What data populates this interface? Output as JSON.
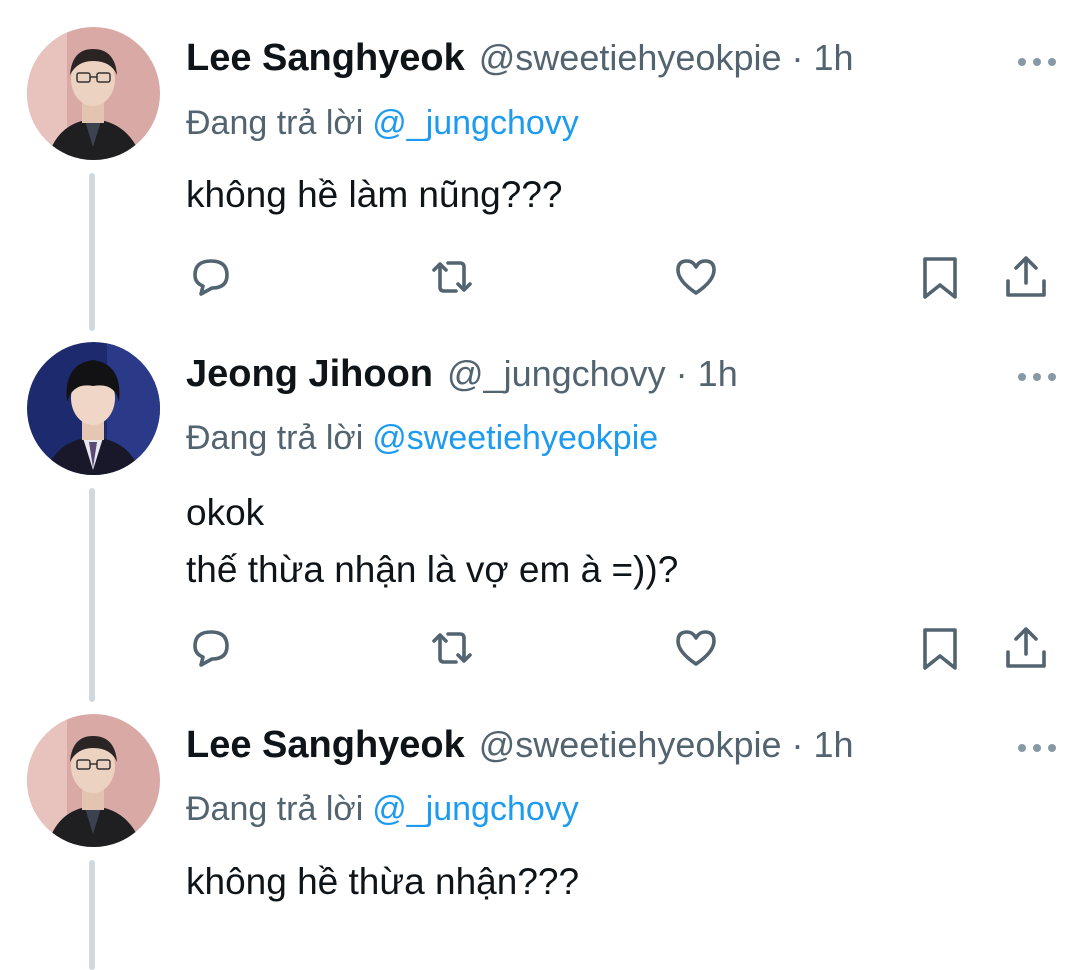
{
  "tweets": [
    {
      "name": "Lee Sanghyeok",
      "handle": "@sweetiehyeokpie",
      "dot": "·",
      "time": "1h",
      "reply_prefix": "Đang trả lời",
      "reply_to": "@_jungchovy",
      "lines": [
        "không hề làm nũng???"
      ],
      "avatar": "avatar-lee-sanghyeok"
    },
    {
      "name": "Jeong Jihoon",
      "handle": "@_jungchovy",
      "dot": "·",
      "time": "1h",
      "reply_prefix": "Đang trả lời",
      "reply_to": "@sweetiehyeokpie",
      "lines": [
        "okok",
        "thế thừa nhận là vợ em à =))?"
      ],
      "avatar": "avatar-jeong-jihoon"
    },
    {
      "name": "Lee Sanghyeok",
      "handle": "@sweetiehyeokpie",
      "dot": "·",
      "time": "1h",
      "reply_prefix": "Đang trả lời",
      "reply_to": "@_jungchovy",
      "lines": [
        "không hề thừa nhận???"
      ],
      "avatar": "avatar-lee-sanghyeok"
    }
  ],
  "icons": {
    "reply": "speech-bubble-icon",
    "retweet": "retweet-icon",
    "like": "heart-icon",
    "bookmark": "bookmark-icon",
    "share": "share-icon",
    "more": "more-dots-icon"
  },
  "colors": {
    "text": "#0f1419",
    "secondary": "#536471",
    "mention": "#1d9bf0",
    "thread_line": "#cfd9de"
  }
}
